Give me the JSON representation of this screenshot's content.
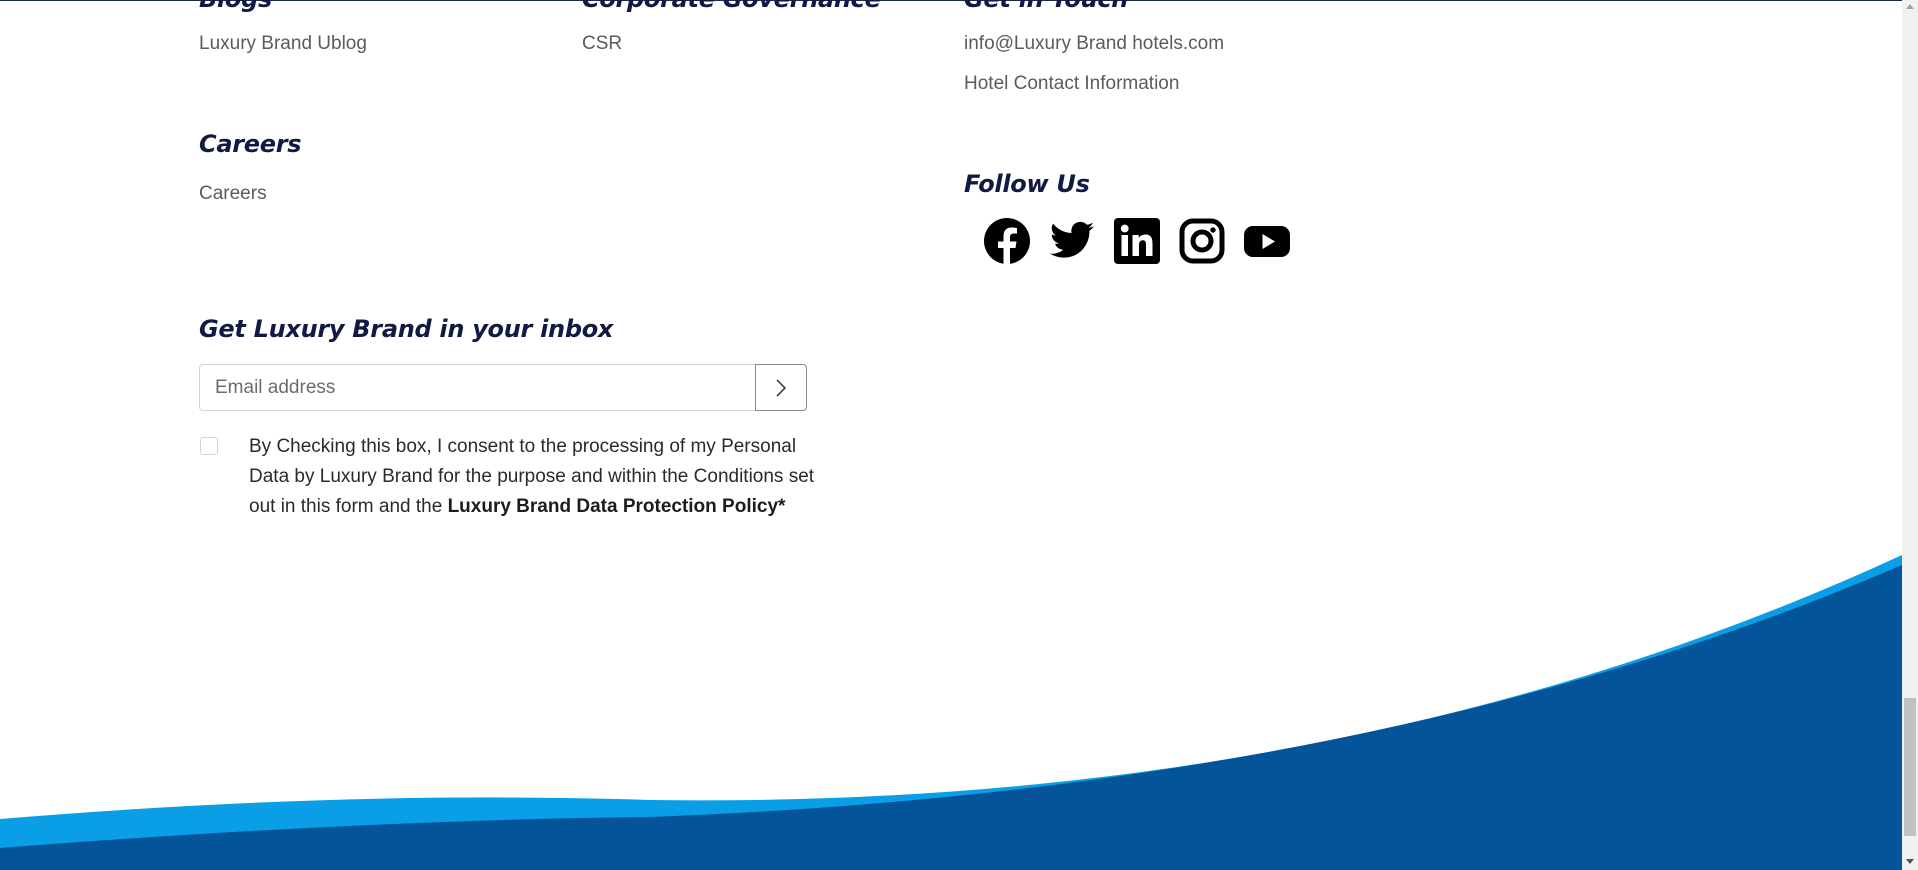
{
  "footer": {
    "columns": [
      {
        "heading": "Blogs",
        "links": [
          "Luxury Brand Ublog"
        ]
      },
      {
        "heading": "Corporate Governance",
        "links": [
          "CSR"
        ]
      },
      {
        "heading": "Get in Touch",
        "links": [
          "info@Luxury Brand hotels.com",
          "Hotel Contact Information"
        ]
      }
    ],
    "careers": {
      "heading": "Careers",
      "link": "Careers"
    },
    "follow": {
      "heading": "Follow Us",
      "icons": [
        "facebook-icon",
        "twitter-icon",
        "linkedin-icon",
        "instagram-icon",
        "youtube-icon"
      ]
    },
    "newsletter": {
      "heading": "Get Luxury Brand in your inbox",
      "email_placeholder": "Email address",
      "submit_icon": "chevron-right-icon",
      "consent_text": "By Checking this box, I consent to the processing of my Personal Data by Luxury Brand for the purpose and within the Conditions set out in this form and the",
      "policy_link": "Luxury Brand Data Protection Policy*"
    }
  },
  "colors": {
    "heading": "#111a44",
    "link": "#5b5b5b",
    "wave_dark": "#04549a",
    "wave_light": "#0a9ee6"
  }
}
